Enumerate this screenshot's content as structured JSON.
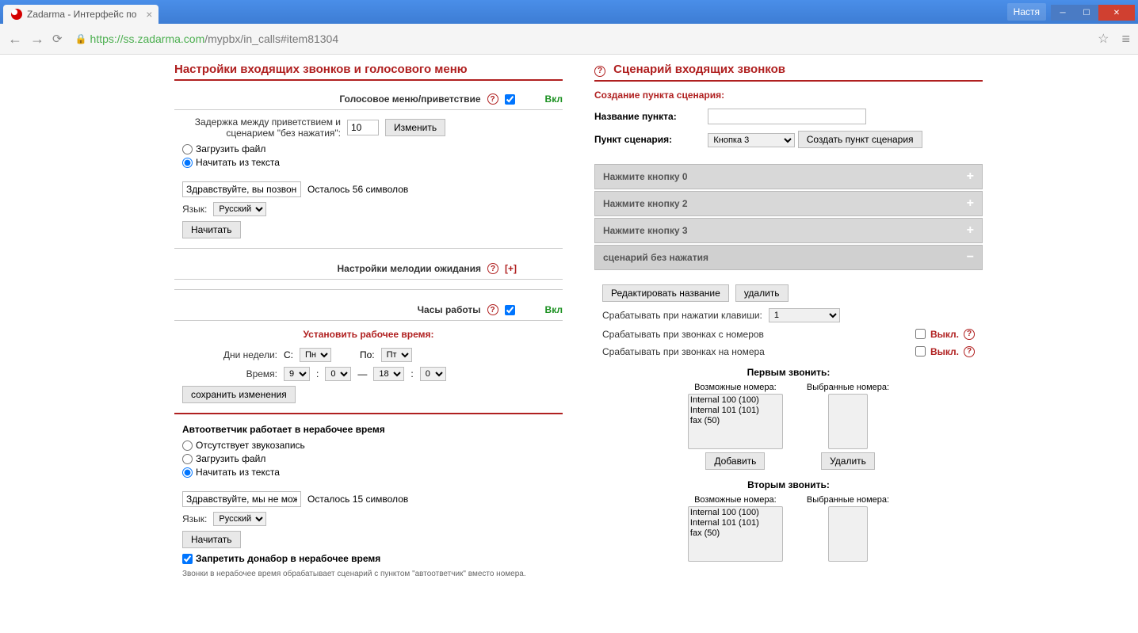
{
  "browser": {
    "tab_title": "Zadarma - Интерфейс по",
    "user": "Настя",
    "url_host": "https://ss.zadarma.com",
    "url_path": "/mypbx/in_calls#item81304"
  },
  "left": {
    "title": "Настройки входящих звонков и голосового меню",
    "voice_menu": {
      "label": "Голосовое меню/приветствие",
      "status": "Вкл",
      "delay_label": "Задержка между приветствием и сценарием \"без нажатия\":",
      "delay_value": "10",
      "change_btn": "Изменить",
      "upload_file": "Загрузить файл",
      "from_text": "Начитать из текста",
      "greeting_text": "Здравствуйте, вы позвон",
      "chars_left": "Осталось 56 символов",
      "lang_label": "Язык:",
      "lang_value": "Русский",
      "speak_btn": "Начитать"
    },
    "hold_music": {
      "label": "Настройки мелодии ожидания",
      "expand": "[+]"
    },
    "work_hours": {
      "label": "Часы работы",
      "status": "Вкл",
      "set_title": "Установить рабочее время:",
      "days_label": "Дни недели:",
      "from_label": "С:",
      "to_label": "По:",
      "day_from": "Пн",
      "day_to": "Пт",
      "time_label": "Время:",
      "h_from": "9",
      "m_from": "0",
      "h_to": "18",
      "m_to": "0",
      "save_btn": "сохранить изменения"
    },
    "answering": {
      "title": "Автоответчик работает в нерабочее время",
      "no_record": "Отсутствует звукозапись",
      "upload_file": "Загрузить файл",
      "from_text": "Начитать из текста",
      "greeting_text": "Здравствуйте, мы не мож",
      "chars_left": "Осталось 15 символов",
      "lang_label": "Язык:",
      "lang_value": "Русский",
      "speak_btn": "Начитать",
      "forbid_label": "Запретить донабор в нерабочее время",
      "note": "Звонки в нерабочее время обрабатывает сценарий с пунктом \"автоответчик\" вместо номера."
    }
  },
  "right": {
    "title": "Сценарий входящих звонков",
    "create_title": "Создание пункта сценария:",
    "name_label": "Название пункта:",
    "point_label": "Пункт сценария:",
    "point_value": "Кнопка 3",
    "create_btn": "Создать пункт сценария",
    "acc": {
      "btn0": "Нажмите кнопку 0",
      "btn2": "Нажмите кнопку 2",
      "btn3": "Нажмите кнопку 3",
      "no_press": "сценарий без нажатия"
    },
    "scenario": {
      "edit_name": "Редактировать название",
      "delete": "удалить",
      "trigger_key": "Срабатывать при нажатии клавиши:",
      "trigger_key_val": "1",
      "trigger_from": "Срабатывать при звонках с номеров",
      "trigger_to": "Срабатывать при звонках на номера",
      "off": "Выкл.",
      "call_first": "Первым звонить:",
      "call_second": "Вторым звонить:",
      "possible": "Возможные номера:",
      "selected": "Выбранные номера:",
      "add_btn": "Добавить",
      "del_btn": "Удалить",
      "numbers": [
        "Internal 100 (100)",
        "Internal 101 (101)",
        "fax (50)"
      ]
    }
  }
}
